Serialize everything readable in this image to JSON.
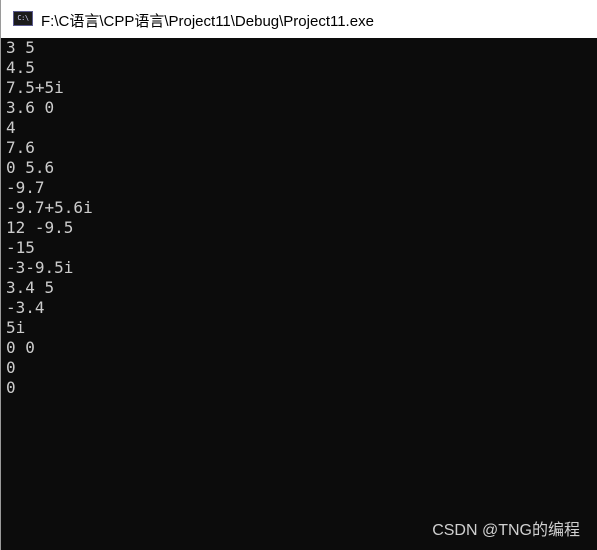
{
  "window": {
    "title": "F:\\C语言\\CPP语言\\Project11\\Debug\\Project11.exe",
    "icon": "console-app-icon",
    "icon_text": "C:\\"
  },
  "console": {
    "background": "#0c0c0c",
    "foreground": "#cccccc",
    "lines": [
      "3 5",
      "4.5",
      "7.5+5i",
      "3.6 0",
      "4",
      "7.6",
      "0 5.6",
      "-9.7",
      "-9.7+5.6i",
      "12 -9.5",
      "-15",
      "-3-9.5i",
      "3.4 5",
      "-3.4",
      "5i",
      "0 0",
      "0",
      "0"
    ]
  },
  "watermark": {
    "text": "CSDN @TNG的编程"
  }
}
